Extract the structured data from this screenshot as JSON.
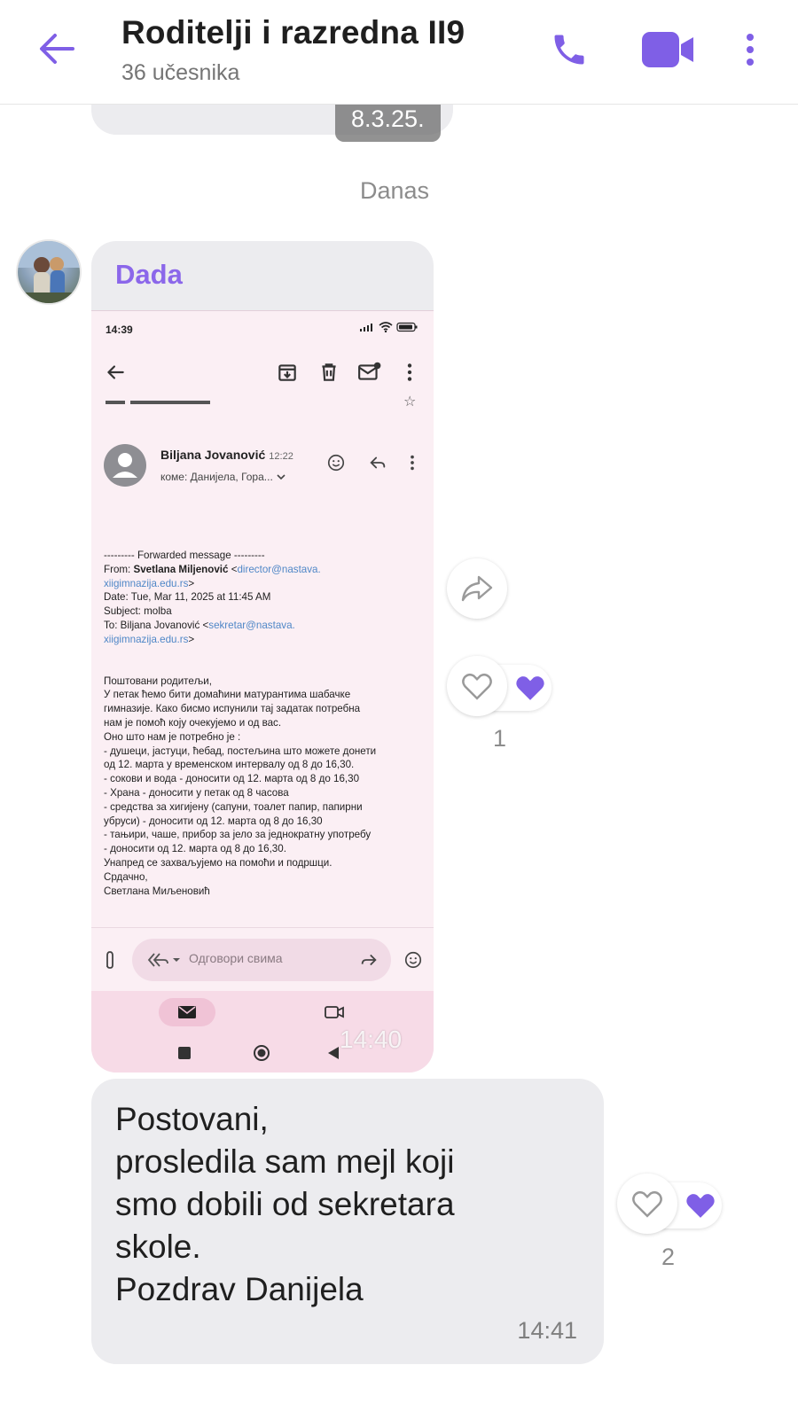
{
  "header": {
    "title": "Roditelji i razredna II9",
    "subtitle": "36 učesnika",
    "accent_color": "#7f5fe6",
    "icons": [
      "back-arrow-icon",
      "phone-icon",
      "video-camera-icon",
      "more-vertical-icon"
    ]
  },
  "previous_message": {
    "time": "8.3.25."
  },
  "date_separator": "Danas",
  "image_message": {
    "sender": "Dada",
    "time": "14:40",
    "screenshot": {
      "status_time": "14:39",
      "from_name": "Biljana Jovanović",
      "from_time": "12:22",
      "to_line": "коме: Данијела, Гора...",
      "email_header": [
        "--------- Forwarded message ---------",
        "From: ",
        "Svetlana Miljenović",
        " <",
        "director@nastava.",
        "xiigimnazija.edu.rs",
        ">",
        "Date: Tue, Mar 11, 2025 at 11:45 AM",
        "Subject: molba",
        "To: Biljana Jovanović <",
        "sekretar@nastava.",
        "xiigimnazija.edu.rs"
      ],
      "email_lines": [
        "Поштовани родитељи,",
        "У петак ћемо бити домаћини матурантима шабачке",
        "гимназије. Како бисмо испунили тај задатак потребна",
        "нам је помоћ коју очекујемо и од вас.",
        "Оно што нам је потребно је :",
        "- душеци, јастуци, ћебад, постељина што можете донети",
        "од 12. марта у временском интервалу од 8 до 16,30.",
        "- сокови и вода - доносити од 12. марта од 8 до 16,30",
        "- Храна - доносити у петак од 8 часова",
        "- средства за хигијену (сапуни, тоалет папир, папирни",
        "убруси) - доносити од 12. марта од 8 до 16,30",
        "- тањири, чаше, прибор за јело за једнократну употребу",
        "- доносити од 12. марта од 8 до 16,30.",
        "Унапред се захваљујемо на помоћи и подршци.",
        "Срдачно,",
        "Светлана Миљеновић"
      ],
      "reply_placeholder": "Одговори свима"
    },
    "reactions": {
      "count": "1"
    }
  },
  "text_message": {
    "body": "Postovani,\nprosledila sam mejl koji\nsmo dobili od sekretara\nskole.\nPozdrav Danijela",
    "time": "14:41",
    "reactions": {
      "count": "2"
    }
  }
}
